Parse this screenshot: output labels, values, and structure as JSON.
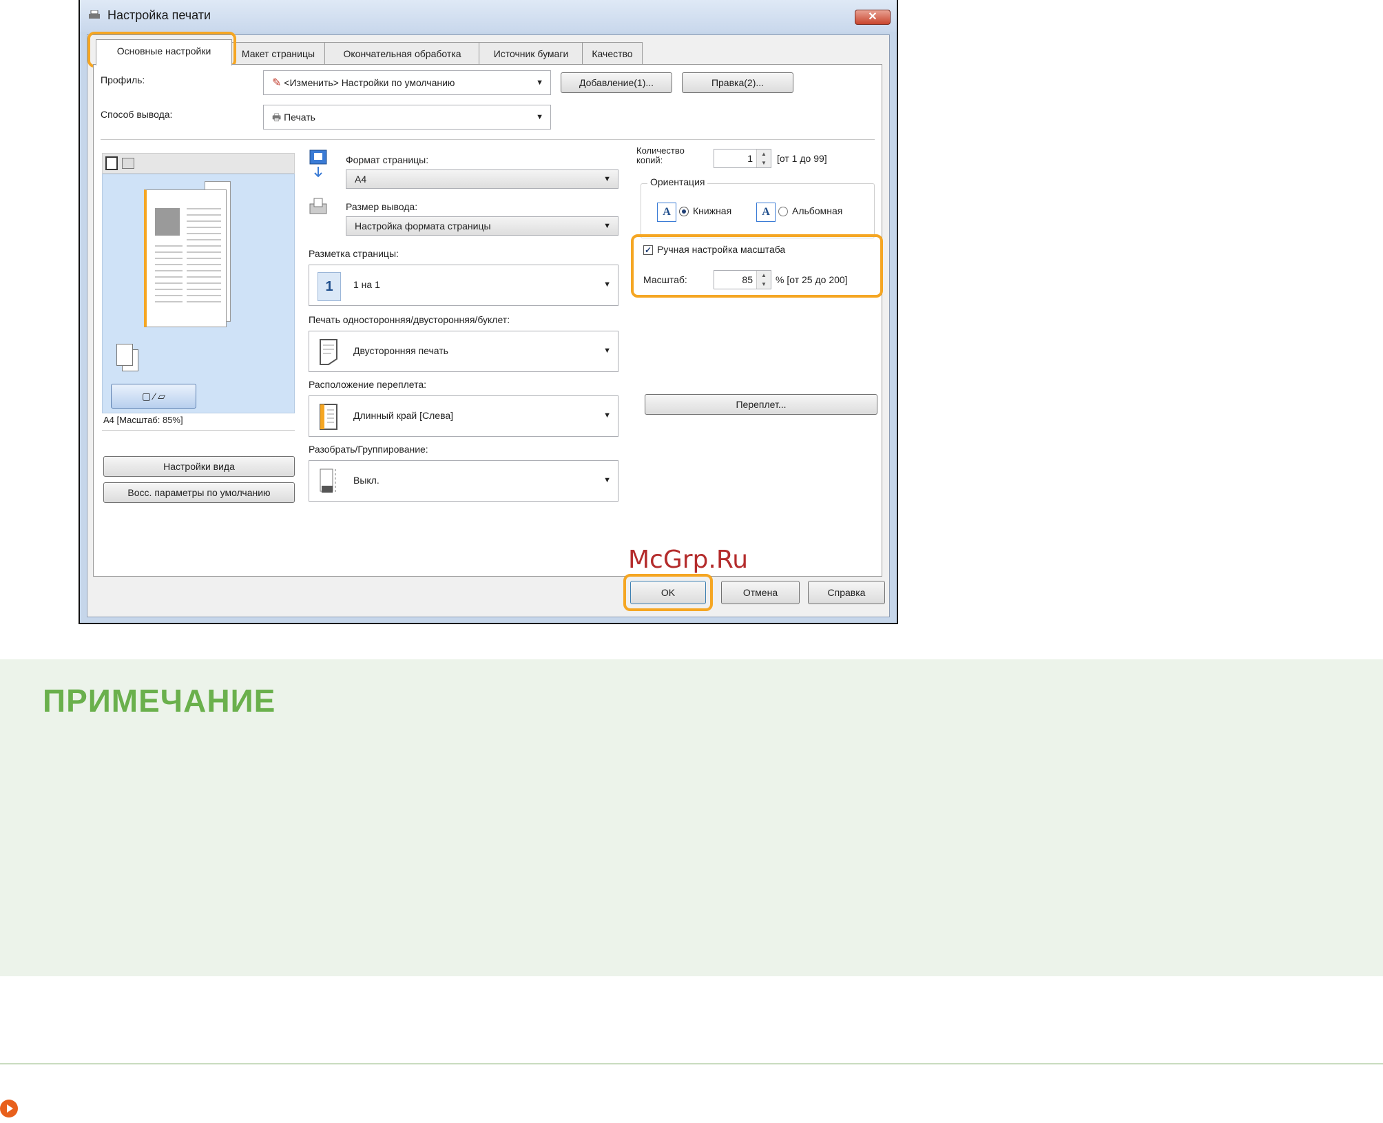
{
  "window": {
    "title": "Настройка печати",
    "close_glyph": "✕"
  },
  "tabs": [
    {
      "label": "Основные настройки"
    },
    {
      "label": "Макет страницы"
    },
    {
      "label": "Окончательная обработка"
    },
    {
      "label": "Источник бумаги"
    },
    {
      "label": "Качество"
    }
  ],
  "profile": {
    "label": "Профиль:",
    "value": "<Изменить> Настройки по умолчанию",
    "add_button": "Добавление(1)...",
    "edit_button": "Правка(2)..."
  },
  "output_method": {
    "label": "Способ вывода:",
    "value": "Печать"
  },
  "preview": {
    "caption": "A4 [Масштаб: 85%]",
    "view_settings_button": "Настройки вида",
    "restore_defaults_button": "Восс. параметры по умолчанию"
  },
  "page_size": {
    "label": "Формат страницы:",
    "value": "A4"
  },
  "output_size": {
    "label": "Размер вывода:",
    "value": "Настройка формата страницы"
  },
  "page_layout": {
    "label": "Разметка страницы:",
    "value": "1 на 1",
    "icon_text": "1"
  },
  "duplex": {
    "label": "Печать односторонняя/двусторонняя/буклет:",
    "value": "Двусторонняя печать"
  },
  "binding_location": {
    "label": "Расположение переплета:",
    "value": "Длинный край [Слева]"
  },
  "collate": {
    "label": "Разобрать/Группирование:",
    "value": "Выкл."
  },
  "copies": {
    "label": "Количество копий:",
    "value": "1",
    "range": "[от 1 до 99]"
  },
  "orientation": {
    "group_label": "Ориентация",
    "portrait": "Книжная",
    "landscape": "Альбомная",
    "selected": "portrait"
  },
  "manual_scaling": {
    "label": "Ручная настройка масштаба",
    "checked": true,
    "scale_label": "Масштаб:",
    "scale_value": "85",
    "scale_range": "% [от 25 до 200]"
  },
  "binding_button": "Переплет...",
  "footer": {
    "ok": "OK",
    "cancel": "Отмена",
    "help": "Справка"
  },
  "watermark": "McGrp.Ru",
  "note": {
    "title": "ПРИМЕЧАНИЕ"
  },
  "colors": {
    "highlight": "#f5a623",
    "note_title": "#6ab04c",
    "note_bg": "#ecf3ea",
    "nav_icon": "#e8601c"
  }
}
